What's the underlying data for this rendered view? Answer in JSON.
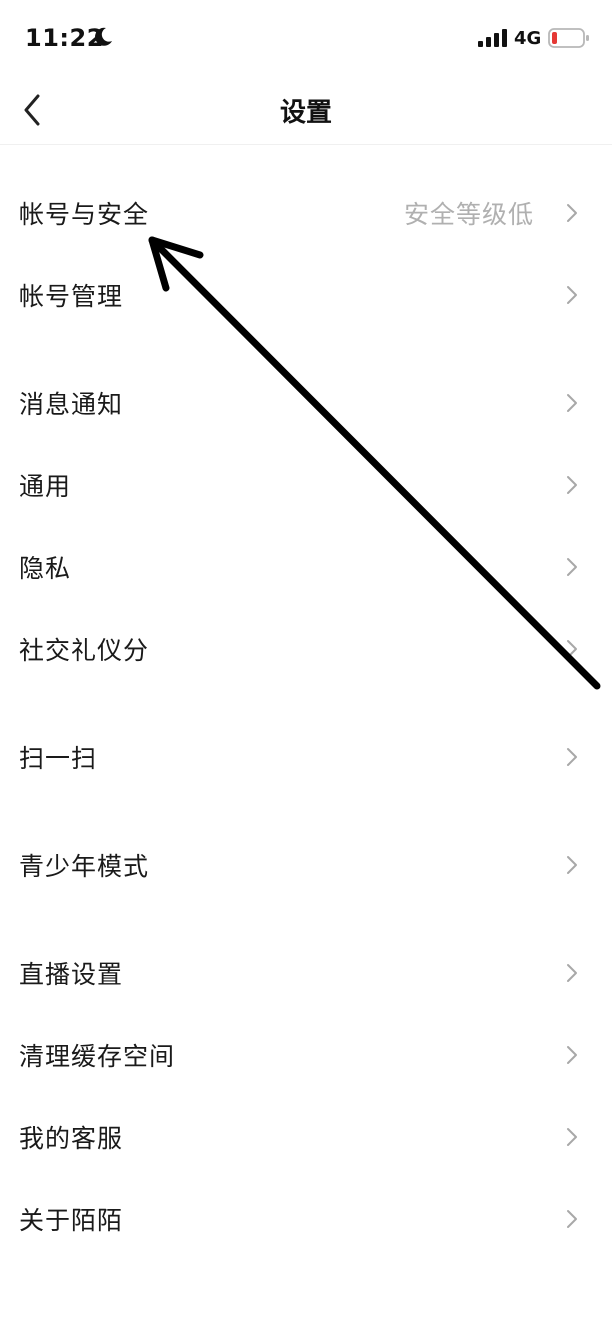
{
  "status_bar": {
    "time": "11:22",
    "network": "4G"
  },
  "nav": {
    "title": "设置"
  },
  "rows": {
    "account_security": {
      "label": "帐号与安全",
      "value": "安全等级低"
    },
    "account_manage": {
      "label": "帐号管理"
    },
    "notifications": {
      "label": "消息通知"
    },
    "general": {
      "label": "通用"
    },
    "privacy": {
      "label": "隐私"
    },
    "social_score": {
      "label": "社交礼仪分"
    },
    "scan": {
      "label": "扫一扫"
    },
    "teen_mode": {
      "label": "青少年模式"
    },
    "live_settings": {
      "label": "直播设置"
    },
    "clear_cache": {
      "label": "清理缓存空间"
    },
    "customer_service": {
      "label": "我的客服"
    },
    "about": {
      "label": "关于陌陌"
    }
  },
  "colors": {
    "accent_text": "#111111",
    "secondary_text": "#b0b0b0",
    "battery_low": "#e53935"
  }
}
